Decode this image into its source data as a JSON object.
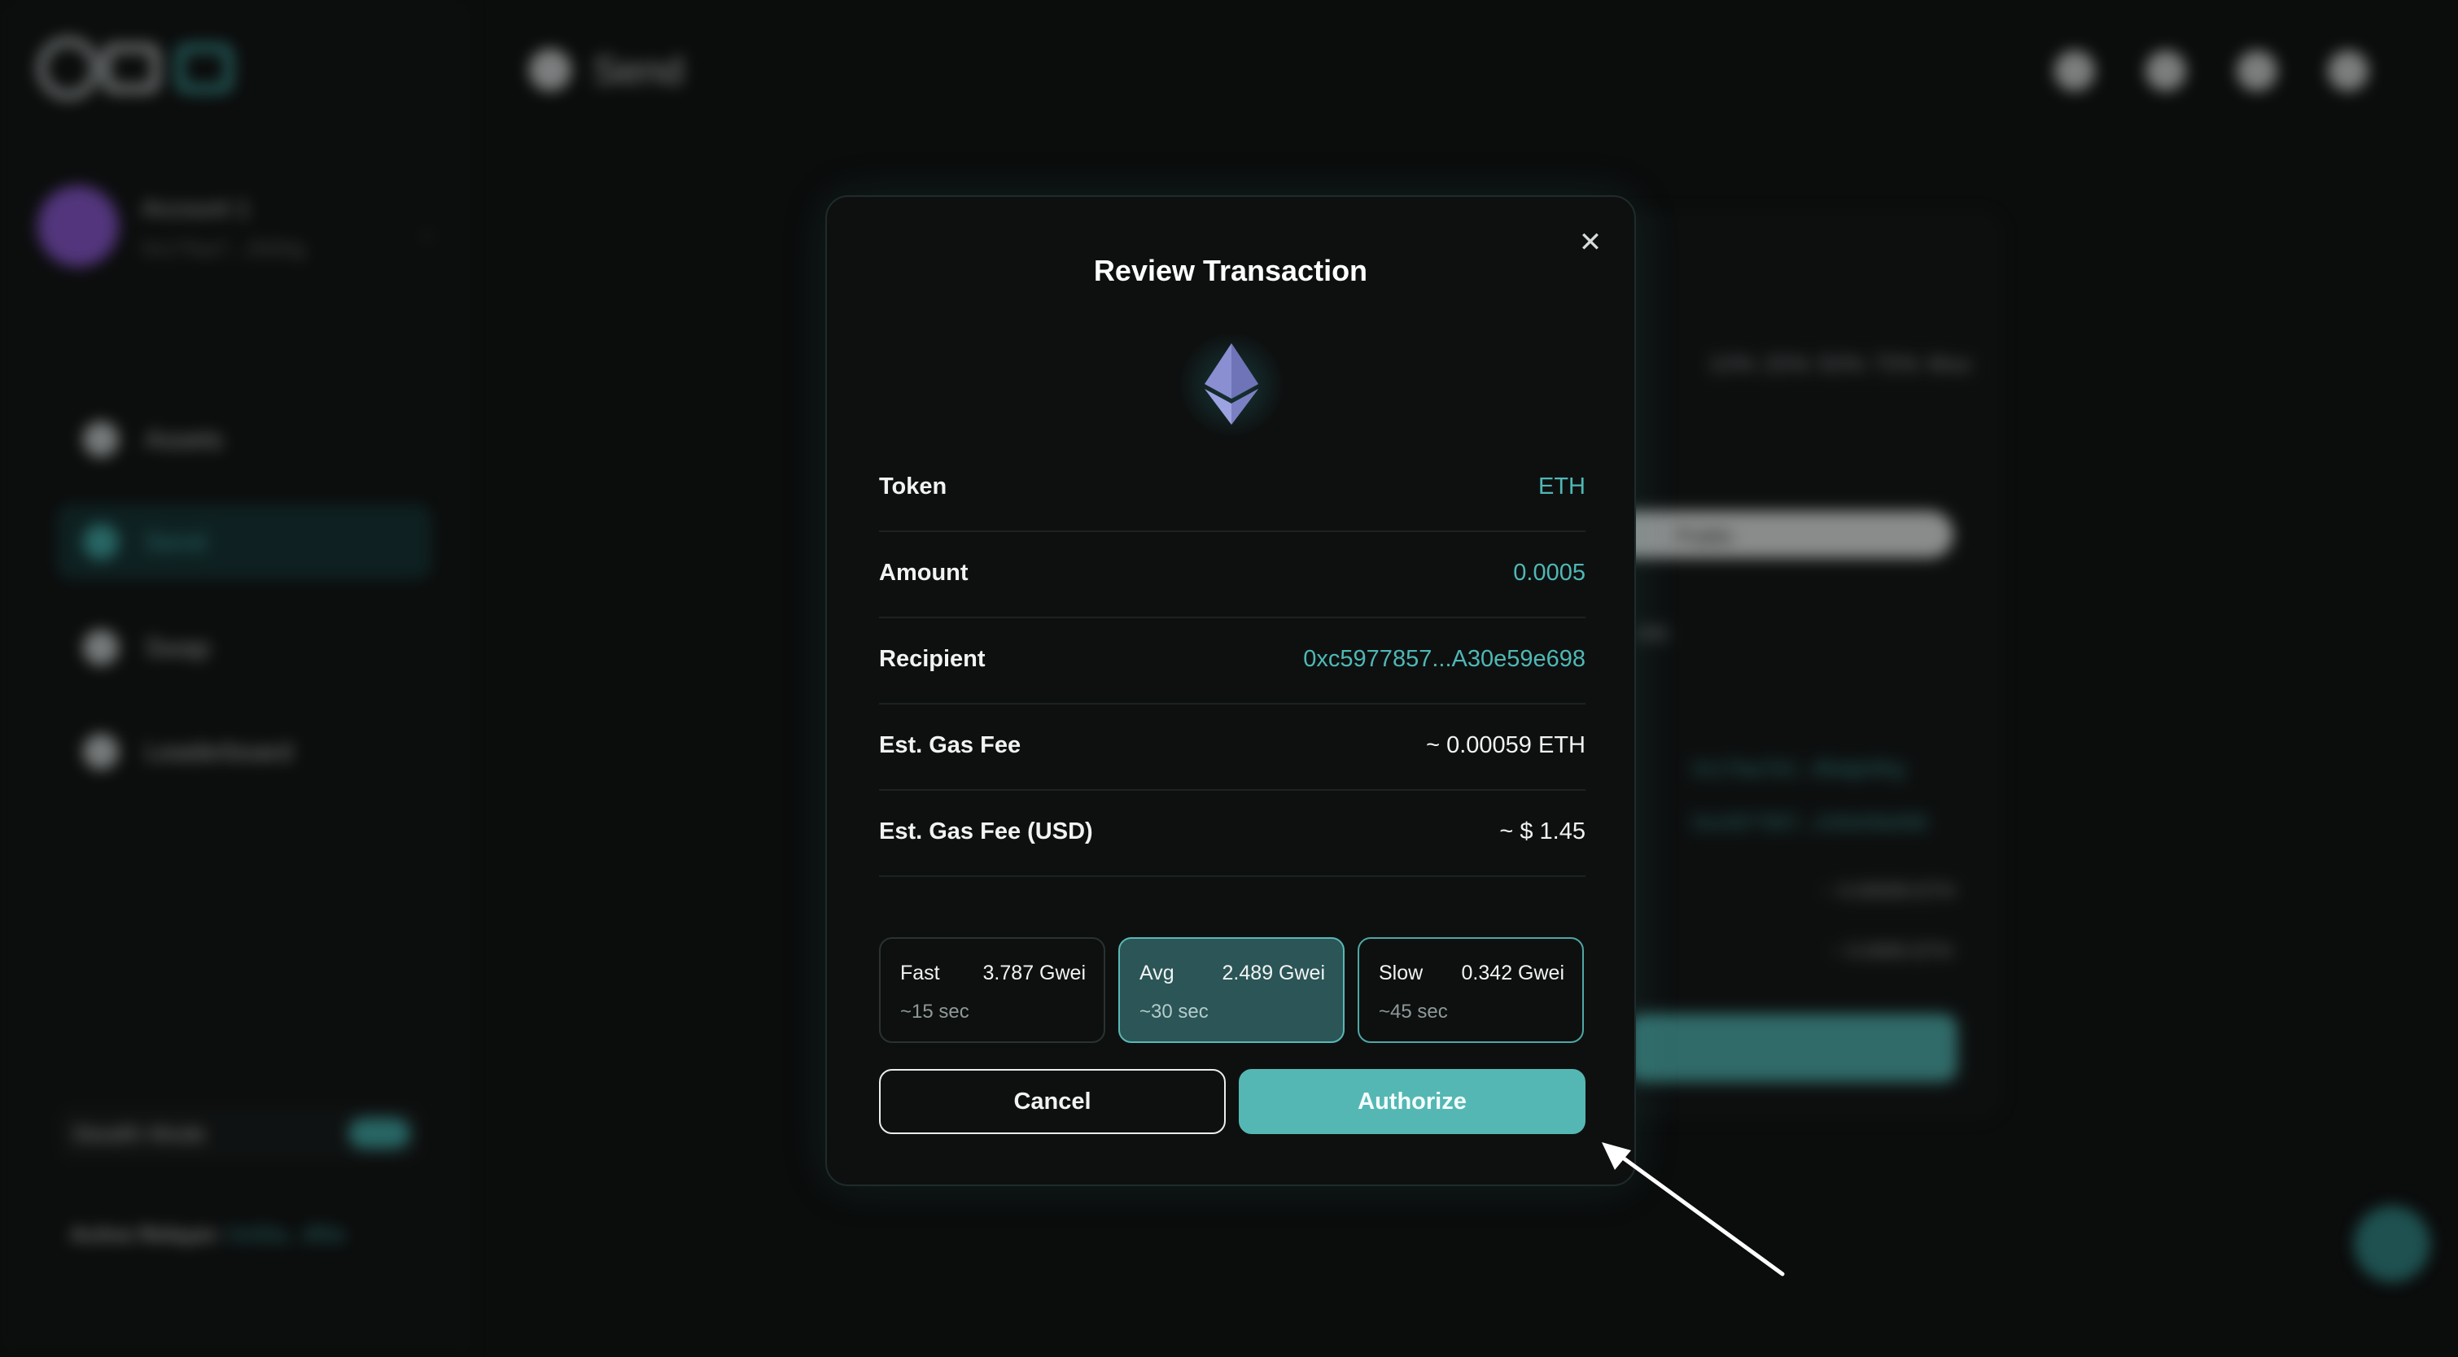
{
  "background": {
    "account_name": "Account 1",
    "account_address": "0x17faa7...2b50g",
    "nav": [
      {
        "label": "Assets"
      },
      {
        "label": "Send"
      },
      {
        "label": "Swap"
      },
      {
        "label": "Leaderboard"
      }
    ],
    "page_title": "Send",
    "stealth_label": "Stealth Mode",
    "relayer_label": "Active Relayer:",
    "relayer_value": "0x00a...8f0e",
    "percent_buttons": "10%  25%  50%  75%  Max",
    "public_label": "Public",
    "address_1": "0x17faa7b3...4fbdgh9hg",
    "address_2": "0xc5977857...A30e59e698",
    "fee_1": "~ 0.00059 ETH",
    "fee_2": "~ 0.0005 ETH",
    "fragment": "005"
  },
  "modal": {
    "title": "Review Transaction",
    "rows": [
      {
        "label": "Token",
        "value": "ETH"
      },
      {
        "label": "Amount",
        "value": "0.0005"
      },
      {
        "label": "Recipient",
        "value": "0xc5977857...A30e59e698"
      },
      {
        "label": "Est. Gas Fee",
        "value": "~ 0.00059 ETH"
      },
      {
        "label": "Est. Gas Fee (USD)",
        "value": "~ $ 1.45"
      }
    ],
    "gas_options": [
      {
        "name": "Fast",
        "gwei": "3.787 Gwei",
        "time": "~15 sec"
      },
      {
        "name": "Avg",
        "gwei": "2.489 Gwei",
        "time": "~30 sec"
      },
      {
        "name": "Slow",
        "gwei": "0.342 Gwei",
        "time": "~45 sec"
      }
    ],
    "cancel_label": "Cancel",
    "authorize_label": "Authorize"
  },
  "colors": {
    "accent": "#55b7b3",
    "selected_gas_bg": "#2b5556",
    "background": "#0b0c0c",
    "modal_bg": "#0e1010"
  },
  "icons": [
    "close-icon",
    "ethereum-icon",
    "cursor-arrow-icon"
  ]
}
